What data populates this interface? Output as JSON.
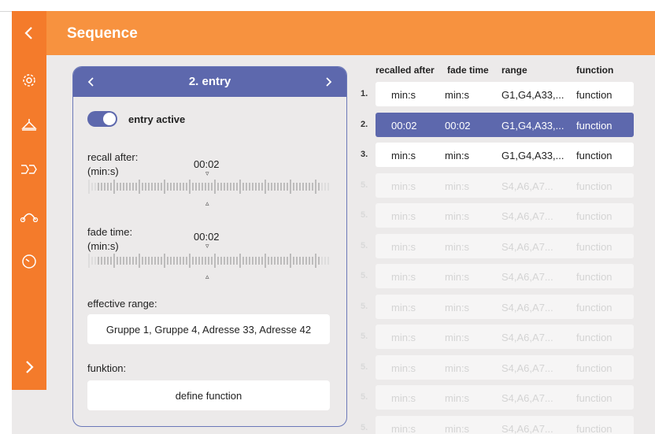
{
  "header": {
    "title": "Sequence"
  },
  "sidebar": {
    "items": [
      {
        "icon": "chevron-left-icon",
        "symbol": "‹"
      },
      {
        "icon": "gear-icon",
        "symbol": "⚙"
      },
      {
        "icon": "lamp-icon",
        "symbol": ""
      },
      {
        "icon": "sequence-icon",
        "symbol": "ᐅᐅ"
      },
      {
        "icon": "route-icon",
        "symbol": ""
      },
      {
        "icon": "gauge-icon",
        "symbol": ""
      },
      {
        "icon": "chevron-right-icon",
        "symbol": "›"
      }
    ]
  },
  "entry_panel": {
    "title": "2. entry",
    "prev_symbol": "‹",
    "next_symbol": "›",
    "toggle_label": "entry active",
    "toggle_on": true,
    "recall_label_line1": "recall after:",
    "recall_label_line2": "(min:s)",
    "recall_value": "00:02",
    "fade_label_line1": "fade time:",
    "fade_label_line2": "(min:s)",
    "fade_value": "00:02",
    "marker_down": "▿",
    "marker_up": "▵",
    "range_label": "effective range:",
    "range_value": "Gruppe 1, Gruppe 4, Adresse 33, Adresse 42",
    "function_label": "funktion:",
    "function_button": "define function"
  },
  "table": {
    "headers": [
      "recalled after",
      "fade time",
      "range",
      "function"
    ],
    "rows": [
      {
        "num": "1.",
        "recalled": "min:s",
        "fade": "min:s",
        "range": "G1,G4,A33,...",
        "function": "function",
        "state": "normal"
      },
      {
        "num": "2.",
        "recalled": "00:02",
        "fade": "00:02",
        "range": "G1,G4,A33,...",
        "function": "function",
        "state": "selected"
      },
      {
        "num": "3.",
        "recalled": "min:s",
        "fade": "min:s",
        "range": "G1,G4,A33,...",
        "function": "function",
        "state": "normal"
      },
      {
        "num": "5.",
        "recalled": "min:s",
        "fade": "min:s",
        "range": "S4,A6,A7...",
        "function": "function",
        "state": "dim"
      },
      {
        "num": "5.",
        "recalled": "min:s",
        "fade": "min:s",
        "range": "S4,A6,A7...",
        "function": "function",
        "state": "dim"
      },
      {
        "num": "5.",
        "recalled": "min:s",
        "fade": "min:s",
        "range": "S4,A6,A7...",
        "function": "function",
        "state": "dim"
      },
      {
        "num": "5.",
        "recalled": "min:s",
        "fade": "min:s",
        "range": "S4,A6,A7...",
        "function": "function",
        "state": "dim"
      },
      {
        "num": "5.",
        "recalled": "min:s",
        "fade": "min:s",
        "range": "S4,A6,A7...",
        "function": "function",
        "state": "dim"
      },
      {
        "num": "5.",
        "recalled": "min:s",
        "fade": "min:s",
        "range": "S4,A6,A7...",
        "function": "function",
        "state": "dim"
      },
      {
        "num": "5.",
        "recalled": "min:s",
        "fade": "min:s",
        "range": "S4,A6,A7...",
        "function": "function",
        "state": "dim"
      },
      {
        "num": "5.",
        "recalled": "min:s",
        "fade": "min:s",
        "range": "S4,A6,A7...",
        "function": "function",
        "state": "dim"
      },
      {
        "num": "5.",
        "recalled": "min:s",
        "fade": "min:s",
        "range": "S4,A6,A7...",
        "function": "function",
        "state": "dim"
      }
    ]
  },
  "colors": {
    "accent_orange": "#f47b2b",
    "header_orange": "#f7923f",
    "primary_blue": "#5d68ad"
  }
}
